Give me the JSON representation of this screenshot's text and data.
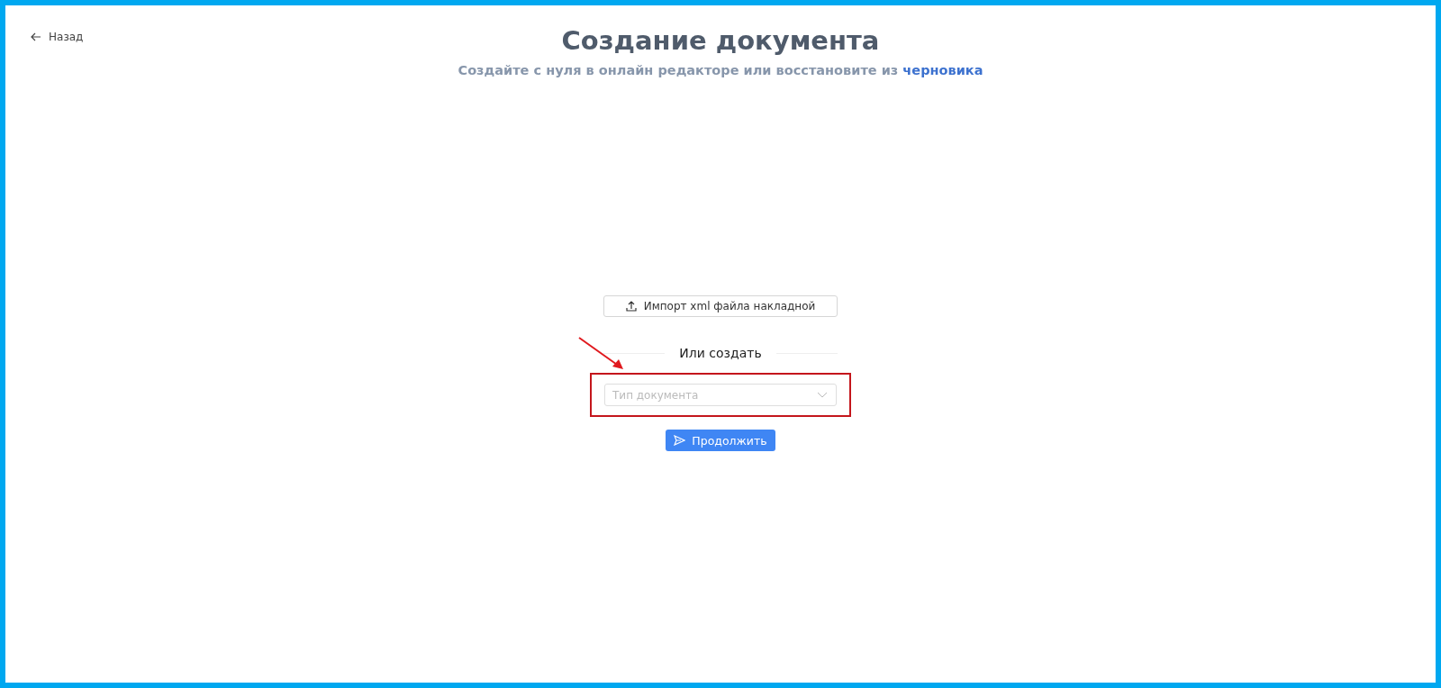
{
  "back_link": {
    "label": "Назад"
  },
  "header": {
    "title": "Создание документа",
    "subtitle": "Создайте с нуля в онлайн редакторе или восстановите из",
    "subtitle_link": "черновика"
  },
  "import_button": {
    "label": "Импорт xml файла накладной"
  },
  "divider": {
    "label": "Или создать"
  },
  "document_type_select": {
    "placeholder": "Тип документа",
    "highlighted": true
  },
  "continue_button": {
    "label": "Продолжить"
  }
}
